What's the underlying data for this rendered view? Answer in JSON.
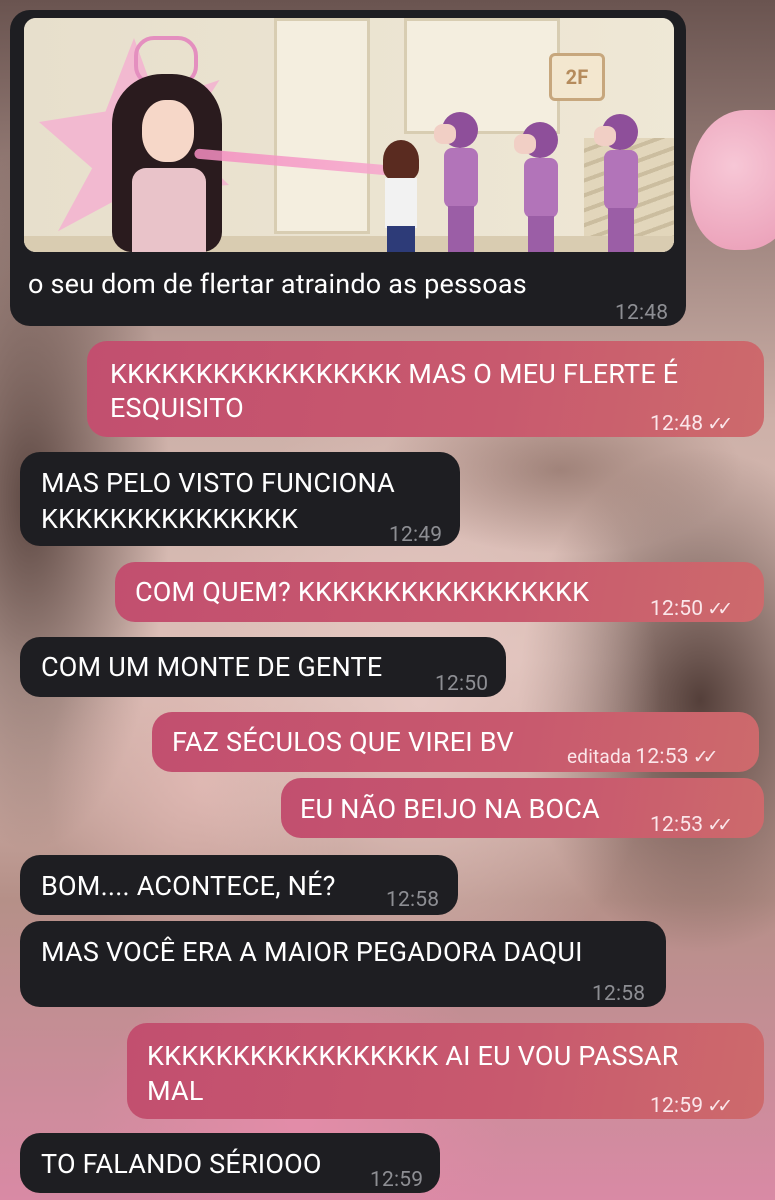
{
  "chat": {
    "media_message": {
      "image_alt": "gif de desenho com menina atraindo personagens",
      "sign_text": "2F",
      "caption": "o seu dom de flertar atraindo as pessoas",
      "time": "12:48"
    },
    "messages": [
      {
        "direction": "out",
        "text_lines": [
          "KKKKKKKKKKKKKKKKK MAS O MEU FLERTE É",
          "ESQUISITO"
        ],
        "time": "12:48",
        "status": "read"
      },
      {
        "direction": "in",
        "text_lines": [
          "MAS PELO VISTO FUNCIONA",
          "KKKKKKKKKKKKKKK"
        ],
        "time": "12:49"
      },
      {
        "direction": "out",
        "text_lines": [
          "COM QUEM? KKKKKKKKKKKKKKKKK"
        ],
        "time": "12:50",
        "status": "read"
      },
      {
        "direction": "in",
        "text_lines": [
          "COM UM MONTE DE GENTE"
        ],
        "time": "12:50"
      },
      {
        "direction": "out",
        "text_lines": [
          "FAZ SÉCULOS QUE VIREI BV"
        ],
        "edited_label": "editada",
        "time": "12:53",
        "status": "read"
      },
      {
        "direction": "out",
        "text_lines": [
          "EU NÃO BEIJO NA BOCA"
        ],
        "time": "12:53",
        "status": "read"
      },
      {
        "direction": "in",
        "text_lines": [
          "BOM.... ACONTECE, NÉ?"
        ],
        "time": "12:58"
      },
      {
        "direction": "in",
        "text_lines": [
          "MAS VOCÊ ERA A MAIOR PEGADORA DAQUI"
        ],
        "time": "12:58"
      },
      {
        "direction": "out",
        "text_lines": [
          "KKKKKKKKKKKKKKKKK AI EU VOU PASSAR",
          "MAL"
        ],
        "time": "12:59",
        "status": "read"
      },
      {
        "direction": "in",
        "text_lines": [
          "TO FALANDO SÉRIOOO"
        ],
        "time": "12:59"
      }
    ],
    "read_ticks_glyph": "✓✓"
  },
  "colors": {
    "incoming_bubble": "#1e1e22",
    "outgoing_bubble": "#c8596e",
    "incoming_time": "#8d8e93"
  }
}
